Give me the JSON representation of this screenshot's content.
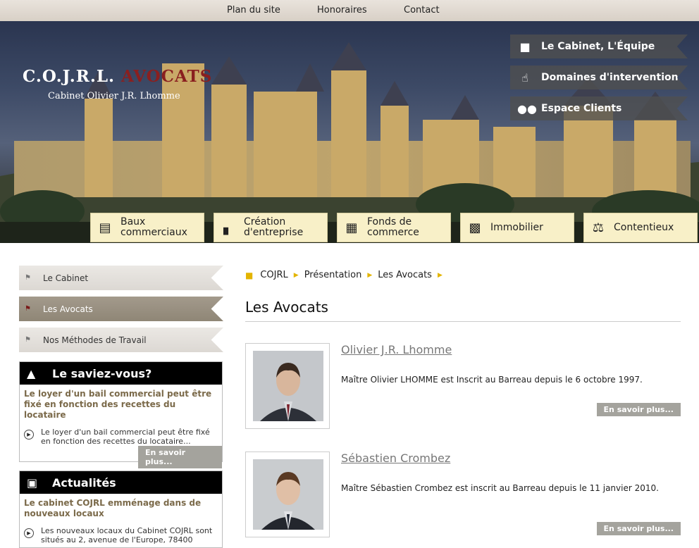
{
  "topnav": {
    "items": [
      "Plan du site",
      "Honoraires",
      "Contact"
    ]
  },
  "brand": {
    "title_main": "C.O.J.R.L.",
    "title_accent": "AVOCATS",
    "subtitle": "Cabinet Olivier J.R. Lhomme"
  },
  "banner_menu": [
    {
      "label": "Le Cabinet, L'Équipe",
      "icon": "receptionist-icon"
    },
    {
      "label": "Domaines d'intervention",
      "icon": "hand-pointer-icon"
    },
    {
      "label": "Espace Clients",
      "icon": "people-icon"
    }
  ],
  "categories": [
    {
      "label_line1": "Baux",
      "label_line2": "commerciaux",
      "icon": "lease-document-icon"
    },
    {
      "label_line1": "Création",
      "label_line2": "d'entreprise",
      "icon": "factory-icon"
    },
    {
      "label_line1": "Fonds de",
      "label_line2": "commerce",
      "icon": "shop-building-icon"
    },
    {
      "label_line1": "Immobilier",
      "label_line2": "",
      "icon": "city-buildings-icon"
    },
    {
      "label_line1": "Contentieux",
      "label_line2": "",
      "icon": "justice-scales-icon"
    }
  ],
  "sidebar": {
    "items": [
      {
        "label": "Le Cabinet",
        "active": false
      },
      {
        "label": "Les Avocats",
        "active": true
      },
      {
        "label": "Nos Méthodes de Travail",
        "active": false
      }
    ]
  },
  "saviez": {
    "title": "Le saviez-vous?",
    "subtitle": "Le loyer d'un bail commercial peut être fixé en fonction des recettes du locataire",
    "item_text": "Le loyer d'un bail commercial peut être fixé en fonction des recettes du locataire...",
    "more": "En savoir plus..."
  },
  "actualites": {
    "title": "Actualités",
    "subtitle": "Le cabinet COJRL emménage dans de nouveaux locaux",
    "item_text": "Les nouveaux locaux du Cabinet COJRL sont situés au 2, avenue de l'Europe, 78400"
  },
  "breadcrumb": [
    "COJRL",
    "Présentation",
    "Les Avocats"
  ],
  "page_title": "Les Avocats",
  "lawyers": [
    {
      "name": "Olivier J.R. Lhomme",
      "description": "Maître Olivier LHOMME est Inscrit au Barreau depuis le 6 octobre 1997.",
      "more": "En savoir plus..."
    },
    {
      "name": "Sébastien Crombez",
      "description": "Maître Sébastien Crombez est inscrit au Barreau depuis le 11 janvier 2010.",
      "more": "En savoir plus..."
    }
  ],
  "colors": {
    "accent_red": "#8a1f1f",
    "tab_bg": "#f8f0c8",
    "breadcrumb_arrow": "#e3b400",
    "button_gray": "#a4a39d",
    "active_menu": "#958c7d"
  }
}
